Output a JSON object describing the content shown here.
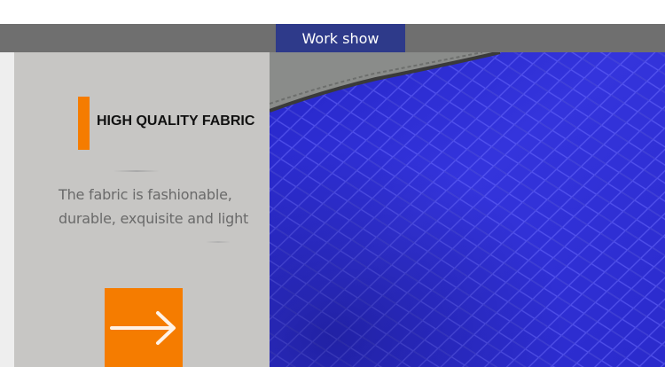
{
  "header": {
    "tab_label": "Work show"
  },
  "feature": {
    "title": "HIGH QUALITY FABRIC",
    "description_line1": "The fabric is fashionable,",
    "description_line2": "durable, exquisite and light"
  },
  "icons": {
    "next": "right-arrow-icon"
  },
  "colors": {
    "accent": "#f57c00",
    "tab_bg": "#2e3a8a",
    "bar_bg": "#6f6f6f",
    "panel_bg": "#c7c6c4",
    "fabric": "#2f2fd6"
  }
}
